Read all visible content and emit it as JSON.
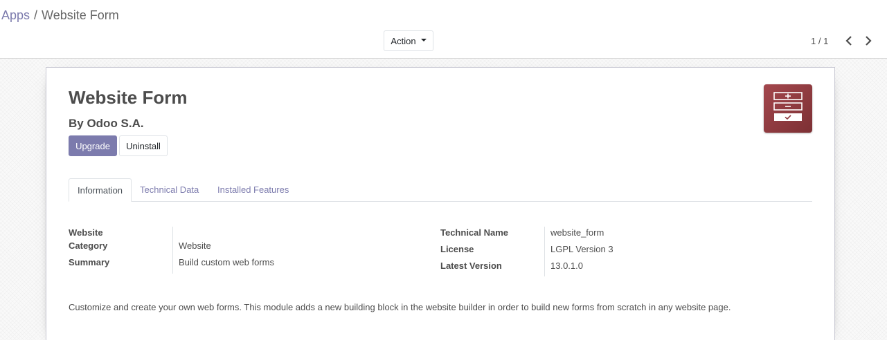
{
  "breadcrumb": {
    "parent": "Apps",
    "separator": "/",
    "current": "Website Form"
  },
  "toolbar": {
    "action_label": "Action"
  },
  "pager": {
    "value": "1 / 1"
  },
  "app": {
    "name": "Website Form",
    "author": "By Odoo S.A.",
    "upgrade_label": "Upgrade",
    "uninstall_label": "Uninstall",
    "icon": "website-form-icon",
    "icon_color": "#8f3b40"
  },
  "tabs": [
    "Information",
    "Technical Data",
    "Installed Features"
  ],
  "info_left": {
    "website_label": "Website",
    "website_value": "",
    "category_label": "Category",
    "category_value": "Website",
    "summary_label": "Summary",
    "summary_value": "Build custom web forms"
  },
  "info_right": {
    "technical_name_label": "Technical Name",
    "technical_name_value": "website_form",
    "license_label": "License",
    "license_value": "LGPL Version 3",
    "latest_version_label": "Latest Version",
    "latest_version_value": "13.0.1.0"
  },
  "description": "Customize and create your own web forms. This module adds a new building block in the website builder in order to build new forms from scratch in any website page.",
  "colors": {
    "accent": "#7c7bad",
    "text": "#4c4c4c"
  }
}
